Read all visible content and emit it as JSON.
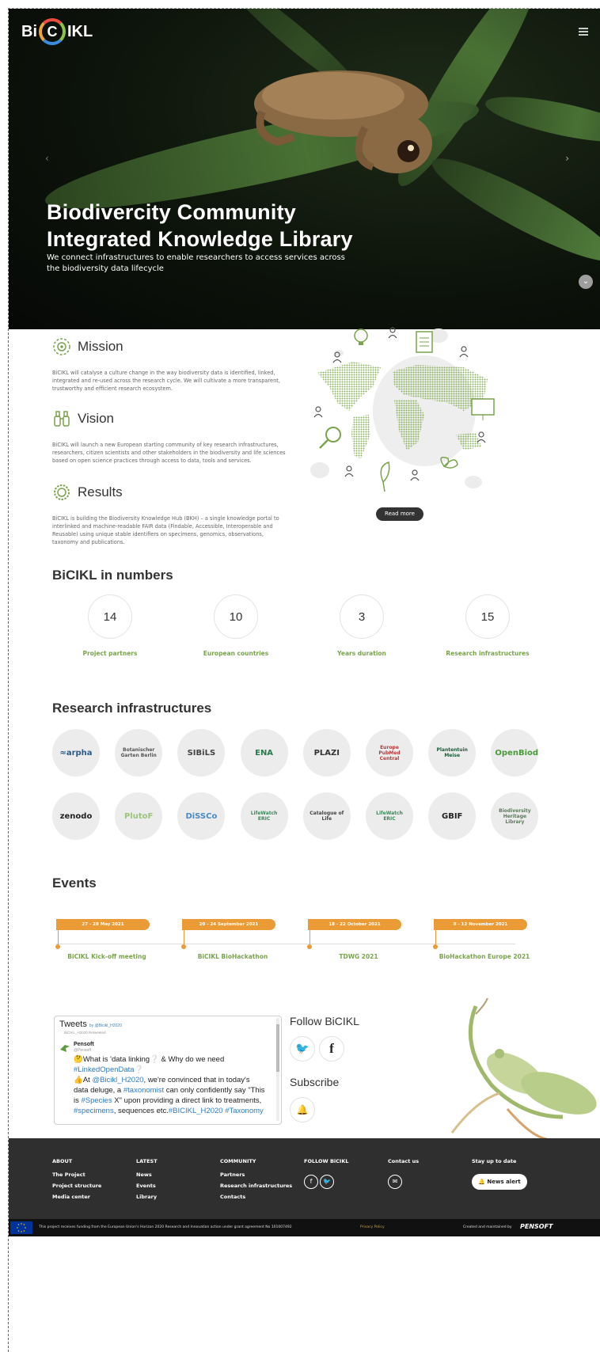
{
  "brand": {
    "logo_left": "Bi",
    "logo_c": "C",
    "logo_right": "IKL"
  },
  "hero": {
    "title_line1": [
      {
        "b": "Bi",
        "t": "odivercity "
      },
      {
        "b": "C",
        "t": "ommunity"
      }
    ],
    "title_line2": [
      {
        "b": "I",
        "t": "ntegrated "
      },
      {
        "b": "K",
        "t": "nowledge "
      },
      {
        "b": "L",
        "t": "ibrary"
      }
    ],
    "subtitle": "We connect infrastructures to enable researchers to access services across the biodiversity data lifecycle",
    "prev_arrow": "‹",
    "next_arrow": "›",
    "scroll_down": "⌄"
  },
  "mission": {
    "title": "Mission",
    "text": "BiCIKL will catalyse a culture change in the way biodiversity data is identified, linked, integrated and re-used across the research cycle. We will cultivate a more transparent, trustworthy and efficient research ecosystem."
  },
  "vision": {
    "title": "Vision",
    "text": "BiCIKL will launch a new European starting community of key research infrastructures, researchers, citizen scientists and other stakeholders in the biodiversity and life sciences based on open science practices through access to data, tools and services."
  },
  "results": {
    "title": "Results",
    "text": "BiCIKL is building the Biodiversity Knowledge Hub (BKH) – a single knowledge portal to interlinked and machine-readable FAIR data (Findable, Accessible, Interoperable and Reusable) using unique stable identifiers on specimens, genomics, observations, taxonomy and publications."
  },
  "read_more": "Read more",
  "numbers": {
    "title": "BiCIKL in numbers",
    "items": [
      {
        "value": "14",
        "label": "Project partners"
      },
      {
        "value": "10",
        "label": "European countries"
      },
      {
        "value": "3",
        "label": "Years duration"
      },
      {
        "value": "15",
        "label": "Research infrastructures"
      }
    ]
  },
  "infrastructures": {
    "title": "Research infrastructures",
    "logos": [
      {
        "name": "arpha",
        "text": "≈arpha",
        "color": "#2c5a8a"
      },
      {
        "name": "bgbm",
        "text": "Botanischer Garten Berlin",
        "color": "#555555"
      },
      {
        "name": "sibils",
        "text": "SIBiLS",
        "color": "#444444"
      },
      {
        "name": "ena",
        "text": "ENA",
        "color": "#2a7a4a"
      },
      {
        "name": "plazi",
        "text": "PLAZI",
        "color": "#333333"
      },
      {
        "name": "europe-pmc",
        "text": "Europe PubMed Central",
        "color": "#b23b3b"
      },
      {
        "name": "plantentuin",
        "text": "Plantentuin Meise",
        "color": "#1f5a3a"
      },
      {
        "name": "openbiodiv",
        "text": "OpenBiodiv",
        "color": "#4a9a3a"
      },
      {
        "name": "zenodo",
        "text": "zenodo",
        "color": "#222222"
      },
      {
        "name": "plutof",
        "text": "PlutoF",
        "color": "#9bc47a"
      },
      {
        "name": "dissco",
        "text": "DiSSCo",
        "color": "#4a8ac4"
      },
      {
        "name": "lifewatch-1",
        "text": "LifeWatch ERIC",
        "color": "#3a8a5a"
      },
      {
        "name": "catalogue-of-life",
        "text": "Catalogue of Life",
        "color": "#444444"
      },
      {
        "name": "lifewatch-2",
        "text": "LifeWatch ERIC",
        "color": "#3a8a5a"
      },
      {
        "name": "gbif",
        "text": "GBIF",
        "color": "#222222"
      },
      {
        "name": "bhl",
        "text": "Biodiversity Heritage Library",
        "color": "#5a7a5a"
      }
    ]
  },
  "events": {
    "title": "Events",
    "items": [
      {
        "date": "27 - 28 May 2021",
        "name": "BiCIKL Kick-off meeting"
      },
      {
        "date": "20 - 24 September 2021",
        "name": "BiCIKL BioHackathon"
      },
      {
        "date": "18 - 22 October 2021",
        "name": "TDWG 2021"
      },
      {
        "date": "8 - 12 November 2021",
        "name": "BioHackathon Europe 2021"
      }
    ]
  },
  "tweets": {
    "title": "Tweets",
    "by": "by @Bicikl_H2020",
    "retweet": "BiCIKL_H2020 Retweeted",
    "author": "Pensoft",
    "handle": "@Pensoft",
    "line1_pre": "🤔What is 'data linking",
    "line1_q": "❔",
    "line1_post": " & Why do we need",
    "line2_tag": "#LinkedOpenData",
    "line2_q": "❔",
    "line3_pre": "👍At ",
    "line3_mention": "@Bicikl_H2020",
    "line3_post": ", we're convinced that in today's",
    "line4_pre": "data deluge, a ",
    "line4_tag": "#taxonomist",
    "line4_post": " can only confidently say \"This",
    "line5_pre": "is ",
    "line5_tag": "#Species",
    "line5_post": " X\" upon providing a direct link to treatments,",
    "line6_tag1": "#specimens",
    "line6_mid": ", sequences etc.",
    "line6_tag2": "#BICIKL_H2020",
    "line6_tag3": "#Taxonomy"
  },
  "follow": {
    "title": "Follow BiCIKL",
    "twitter": "🐦",
    "facebook": "f"
  },
  "subscribe": {
    "title": "Subscribe",
    "bell": "🔔"
  },
  "footer": {
    "about": {
      "head": "ABOUT",
      "links": [
        "The Project",
        "Project structure",
        "Media center"
      ]
    },
    "latest": {
      "head": "LATEST",
      "links": [
        "News",
        "Events",
        "Library"
      ]
    },
    "community": {
      "head": "COMMUNITY",
      "links": [
        "Partners",
        "Research infrastructures",
        "Contacts"
      ]
    },
    "follow": {
      "head": "FOLLOW BiCIKL",
      "facebook": "f",
      "twitter": "🐦"
    },
    "contact": {
      "head": "Contact us",
      "mail": "✉"
    },
    "stay": {
      "head": "Stay up to date",
      "button": "🔔 News alert"
    }
  },
  "bottombar": {
    "funding": "This project receives funding from the European Union's Horizon 2020 Research and Innovation action under grant agreement No 101007492",
    "policy": "Privacy Policy",
    "created": "Created and maintained by",
    "pensoft": "PENSOFT"
  }
}
